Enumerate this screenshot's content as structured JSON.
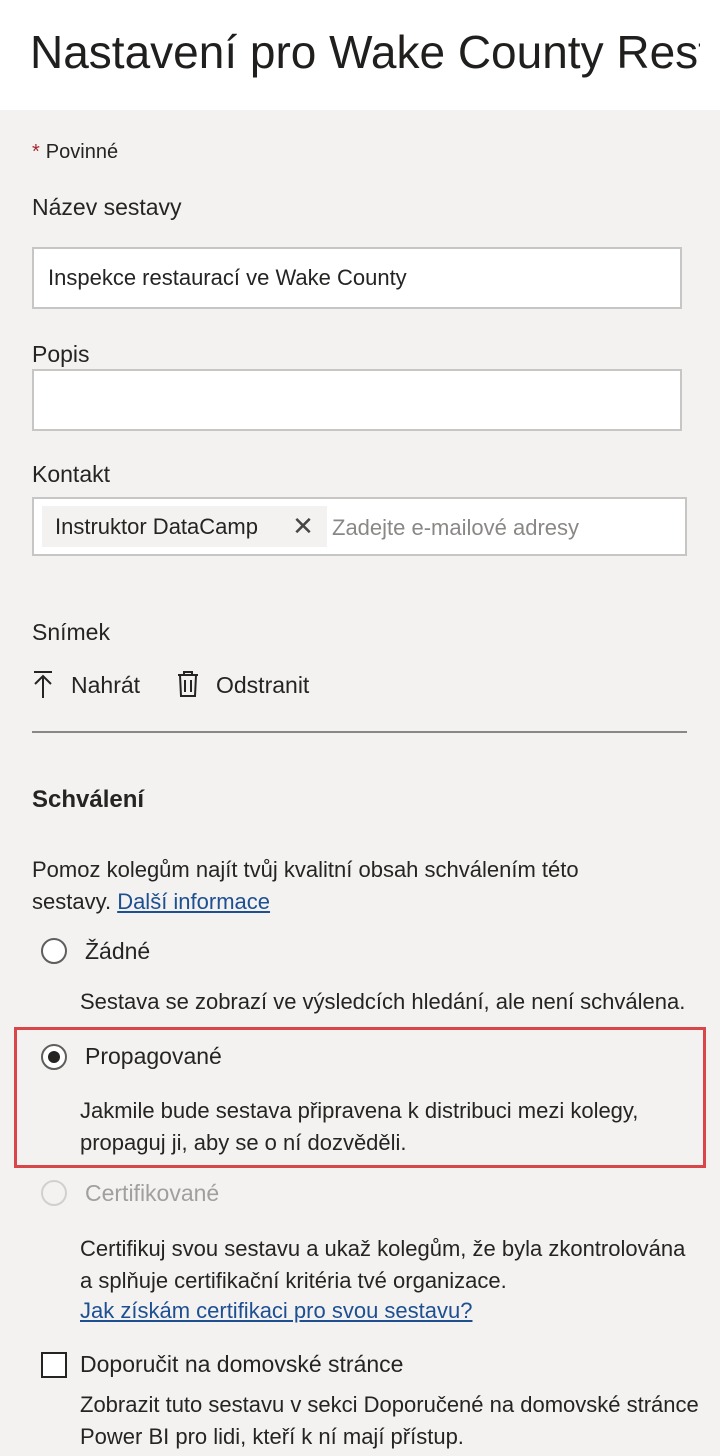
{
  "header": {
    "title": "Nastavení pro Wake County Rest..."
  },
  "required_note": {
    "star": "*",
    "text": "Povinné"
  },
  "name_field": {
    "label": "Název sestavy",
    "value": "Inspekce restaurací ve Wake County"
  },
  "description_field": {
    "label": "Popis",
    "value": ""
  },
  "contact_field": {
    "label": "Kontakt",
    "chip": "Instruktor DataCamp",
    "remove_glyph": "✕",
    "placeholder": "Zadejte e-mailové adresy"
  },
  "snapshot": {
    "label": "Snímek",
    "upload_label": "Nahrát",
    "delete_label": "Odstranit"
  },
  "endorsement": {
    "title": "Schválení",
    "intro": "Pomoz kolegům najít tvůj kvalitní obsah schválením této sestavy.",
    "intro_link": "Další informace",
    "options": [
      {
        "label": "Žádné",
        "description": "Sestava se zobrazí ve výsledcích hledání, ale není schválena.",
        "selected": false,
        "disabled": false
      },
      {
        "label": "Propagované",
        "description": "Jakmile bude sestava připravena k distribuci mezi kolegy, propaguj ji, aby se o ní dozvěděli.",
        "selected": true,
        "disabled": false
      },
      {
        "label": "Certifikované",
        "description": "Certifikuj svou sestavu a ukaž kolegům, že byla zkontrolována a splňuje certifikační kritéria tvé organizace.",
        "link": "Jak získám certifikaci pro svou sestavu?",
        "selected": false,
        "disabled": true
      }
    ]
  },
  "feature": {
    "checkbox_label": "Doporučit na domovské stránce",
    "checked": false,
    "description": "Zobrazit tuto sestavu v sekci Doporučené na domovské stránce Power BI pro lidi, kteří k ní mají přístup."
  },
  "colors": {
    "accent_link": "#1d4f91",
    "highlight_border": "#d9464a",
    "required_star": "#a4262c"
  }
}
